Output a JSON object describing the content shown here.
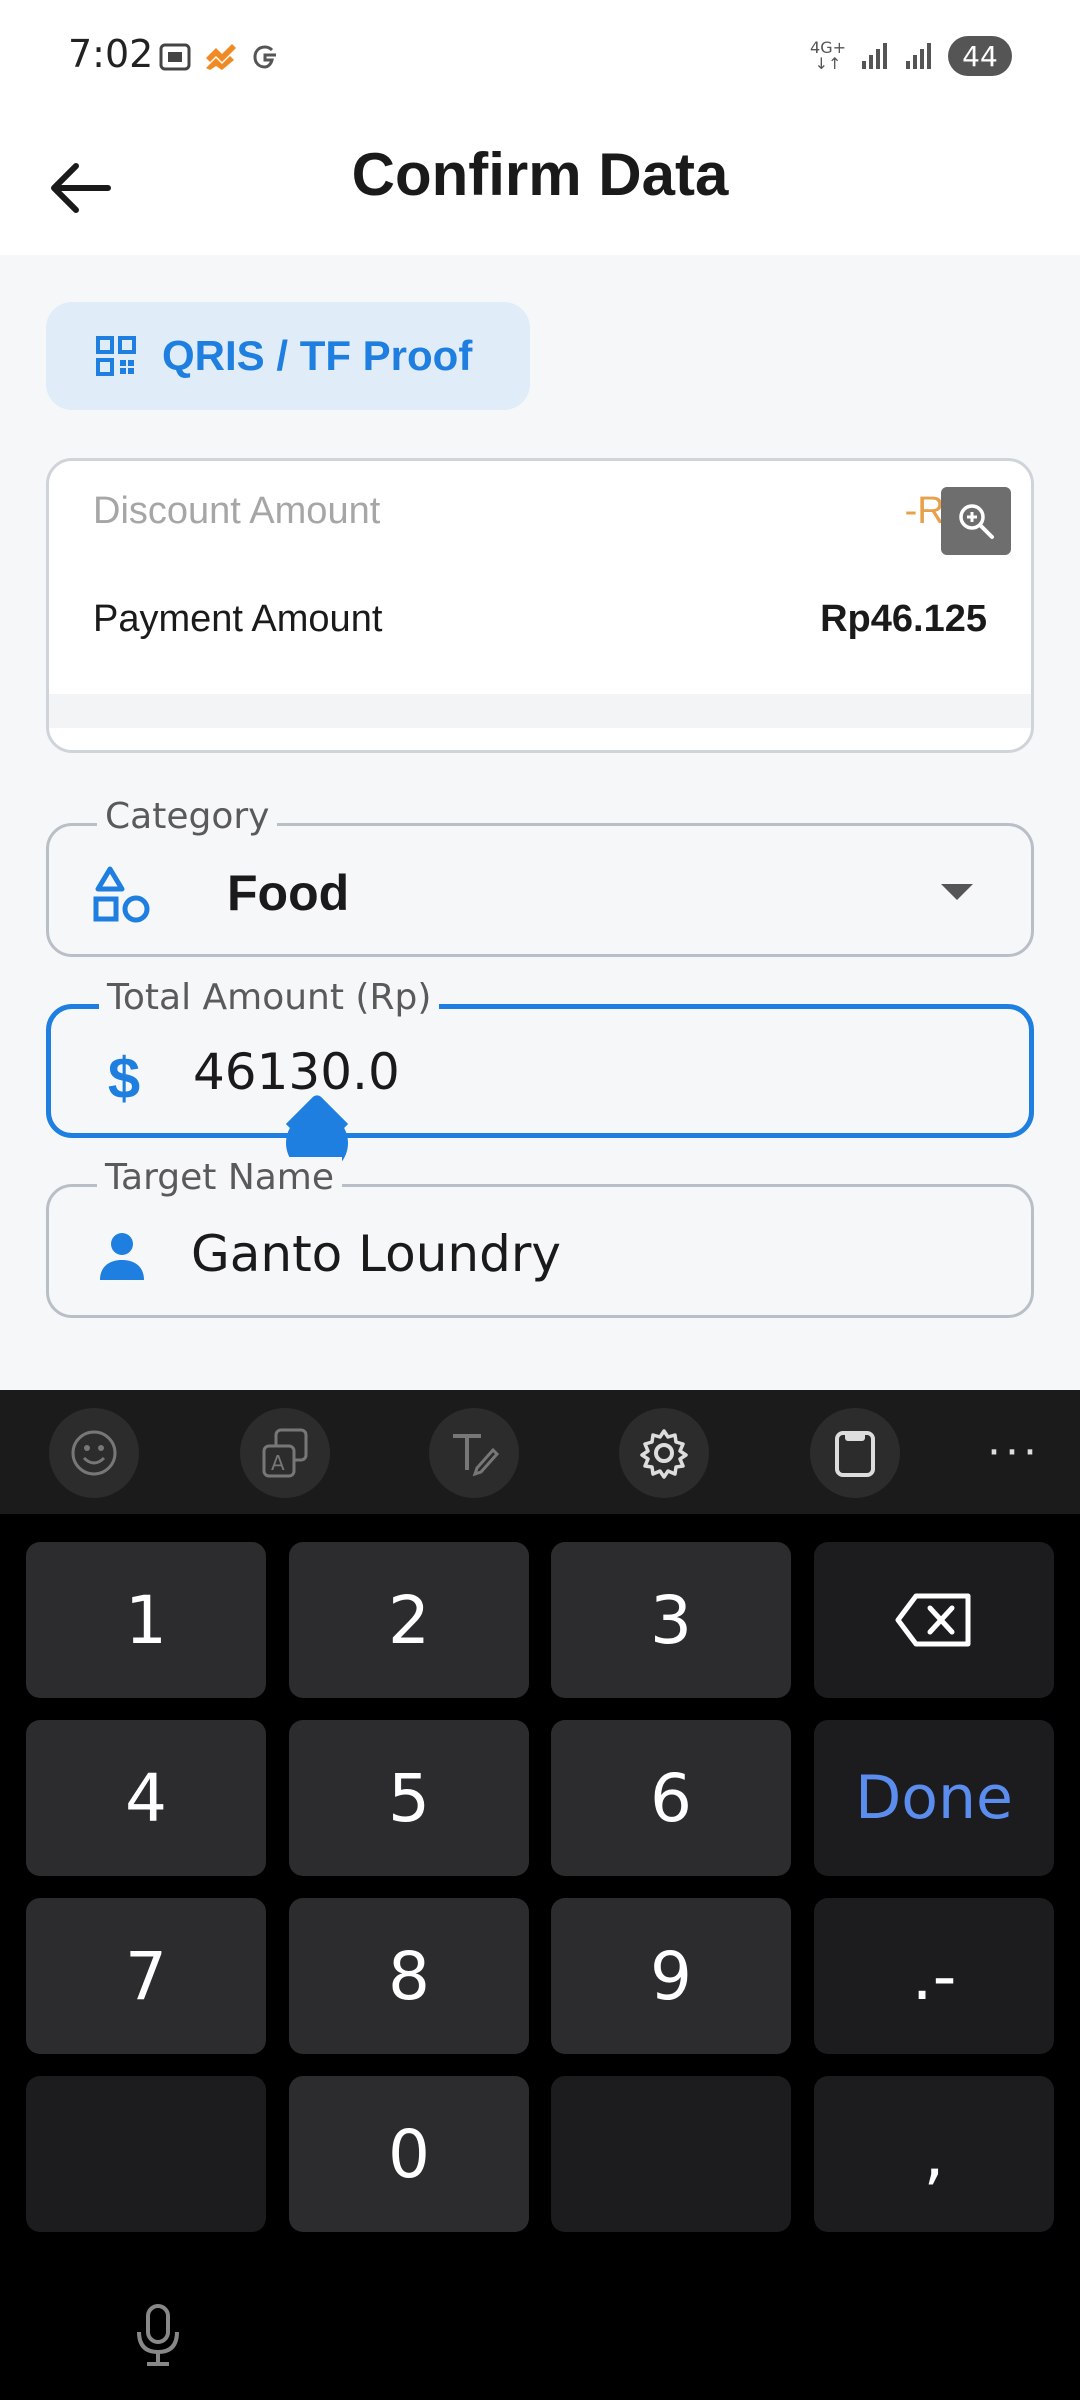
{
  "status_bar": {
    "time": "7:02",
    "network": "4G+",
    "battery": "44"
  },
  "app_bar": {
    "title": "Confirm Data"
  },
  "proof_button": {
    "label": "QRIS / TF Proof"
  },
  "summary": {
    "discount_label": "Discount Amount",
    "discount_value": "-Rp5",
    "payment_label": "Payment Amount",
    "payment_value": "Rp46.125"
  },
  "form": {
    "category": {
      "label": "Category",
      "value": "Food"
    },
    "total_amount": {
      "label": "Total Amount (Rp)",
      "value": "46130.0"
    },
    "target_name": {
      "label": "Target Name",
      "value": "Ganto Loundry"
    }
  },
  "keyboard": {
    "toolbar": [
      "emoji-icon",
      "translate-icon",
      "handwriting-icon",
      "gear-icon",
      "clipboard-icon",
      "more-icon"
    ],
    "keys": {
      "k1": "1",
      "k2": "2",
      "k3": "3",
      "k4": "4",
      "k5": "5",
      "k6": "6",
      "k7": "7",
      "k8": "8",
      "k9": "9",
      "k0": "0",
      "done": "Done",
      "dot_dash": ".-",
      "comma": ","
    }
  },
  "colors": {
    "accent": "#1e7fe0",
    "discount": "#e8a04a",
    "done_key": "#5b8def"
  }
}
